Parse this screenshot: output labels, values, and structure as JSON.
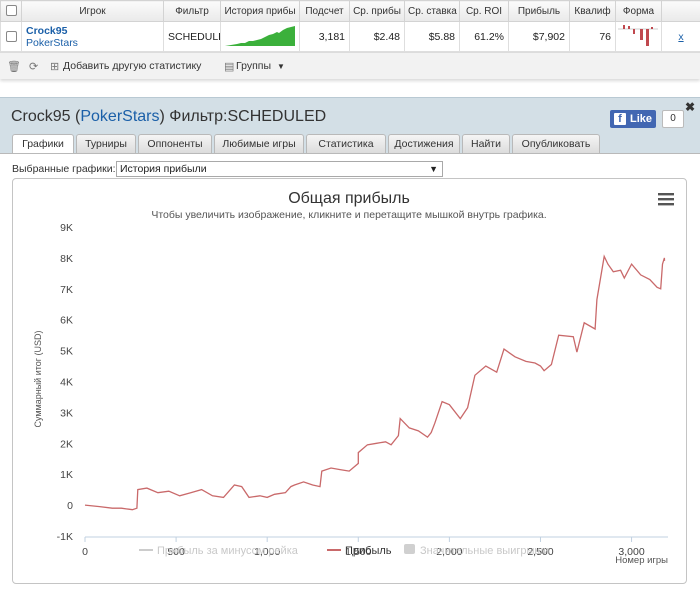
{
  "stats_table": {
    "headers": [
      "Игрок",
      "Фильтр",
      "История прибыли",
      "Подсчет",
      "Ср. прибыль",
      "Ср. ставка",
      "Ср. ROI",
      "Прибыль",
      "Квалиф.",
      "Форма"
    ],
    "header_display": [
      "Игрок",
      "Фильтр",
      "История прибы",
      "Подсчет",
      "Ср. прибы",
      "Ср. ставка",
      "Ср. ROI",
      "Прибыль",
      "Квалиф",
      "Форма"
    ],
    "row": {
      "player": "Crock95",
      "site": "PokerStars",
      "filter": "SCHEDULED",
      "count": "3,181",
      "avg_profit": "$2.48",
      "avg_stake": "$5.88",
      "avg_roi": "61.2%",
      "profit": "$7,902",
      "qualif": "76",
      "remove": "x"
    }
  },
  "toolbar": {
    "add_stats_label": "Добавить другую статистику",
    "groups_label": "Группы"
  },
  "panel": {
    "title_player": "Crock95",
    "title_site": "PokerStars",
    "title_filter": "Фильтр:SCHEDULED",
    "fb_like_label": "Like",
    "fb_like_count": "0",
    "tabs": [
      "Графики",
      "Турниры",
      "Оппоненты",
      "Любимые игры",
      "Статистика",
      "Достижения",
      "Найти",
      "Опубликовать"
    ],
    "active_tab": "Графики",
    "selected_charts_label": "Выбранные графики:",
    "selected_chart_value": "История прибыли"
  },
  "colors": {
    "profit_line": "#c9696a",
    "rake_line": "#cccccc",
    "panel_bg": "#d3dfe6",
    "link": "#1a5fa8",
    "sparkline": "#3bb03b",
    "form_bars": "#c0484e"
  },
  "icons": {
    "menu": "hamburger-menu-icon",
    "delete": "trash-icon",
    "refresh": "refresh-icon",
    "add": "add-stats-icon",
    "groups": "groups-icon",
    "close": "close-icon"
  },
  "chart_data": {
    "type": "line",
    "title": "Общая прибыль",
    "subtitle": "Чтобы увеличить изображение, кликните и перетащите мышкой внутрь графика.",
    "ylabel": "Суммарный итог (USD)",
    "xlabel": "Номер игры",
    "x_range": [
      0,
      3200
    ],
    "ylim": [
      -1000,
      9000
    ],
    "y_ticks": [
      "-1K",
      "0",
      "1K",
      "2K",
      "3K",
      "4K",
      "5K",
      "6K",
      "7K",
      "8K",
      "9K"
    ],
    "x_ticks": [
      "0",
      "500",
      "1,000",
      "1,500",
      "2,000",
      "2,500",
      "3,000"
    ],
    "grid": false,
    "legend_position": "bottom",
    "legend": [
      {
        "name": "Прибыль за минусом рейка",
        "enabled": false
      },
      {
        "name": "Прибыль",
        "enabled": true
      },
      {
        "name": "Значительные выигрыши",
        "enabled": false
      }
    ],
    "series": [
      {
        "name": "Прибыль",
        "x": [
          0,
          80,
          150,
          200,
          260,
          285,
          290,
          340,
          400,
          460,
          520,
          580,
          640,
          700,
          760,
          820,
          860,
          900,
          960,
          1000,
          1040,
          1100,
          1130,
          1150,
          1200,
          1250,
          1290,
          1300,
          1350,
          1400,
          1450,
          1500,
          1500,
          1550,
          1600,
          1650,
          1680,
          1720,
          1730,
          1780,
          1830,
          1880,
          1900,
          1920,
          1960,
          2000,
          2060,
          2100,
          2140,
          2200,
          2260,
          2300,
          2360,
          2420,
          2470,
          2500,
          2520,
          2560,
          2600,
          2680,
          2700,
          2740,
          2800,
          2810,
          2850,
          2870,
          2900,
          2940,
          2960,
          3000,
          3050,
          3100,
          3140,
          3160,
          3170,
          3180,
          3181
        ],
        "y": [
          0,
          -50,
          -100,
          -100,
          -150,
          -100,
          500,
          550,
          400,
          450,
          300,
          400,
          500,
          300,
          250,
          650,
          600,
          250,
          300,
          250,
          350,
          400,
          600,
          650,
          750,
          650,
          600,
          1100,
          1200,
          1150,
          1100,
          1350,
          1700,
          1950,
          2000,
          2050,
          1950,
          2250,
          2800,
          2500,
          2400,
          2200,
          2350,
          2650,
          3350,
          3250,
          2800,
          3150,
          4200,
          4500,
          4300,
          5050,
          4800,
          4650,
          4600,
          4500,
          4350,
          4550,
          5500,
          5450,
          4950,
          5900,
          5700,
          6650,
          8050,
          7800,
          7550,
          7600,
          7350,
          7800,
          7450,
          7300,
          7050,
          7000,
          7800,
          8000,
          7902
        ]
      }
    ]
  }
}
